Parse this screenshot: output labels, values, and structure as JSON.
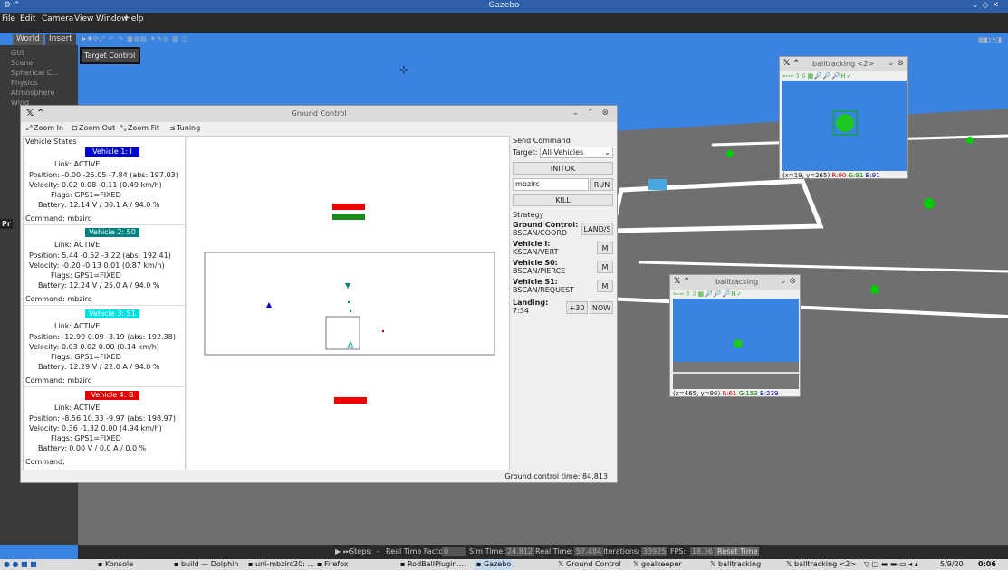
{
  "gazebo": {
    "title": "Gazebo",
    "menu": [
      "File",
      "Edit",
      "Camera",
      "View",
      "Window",
      "Help"
    ],
    "tabs": [
      "World",
      "Insert"
    ],
    "left_items": [
      "GUI",
      "Scene",
      "Spherical C...",
      "Physics",
      "Atmosphere",
      "Wind"
    ],
    "left_short": "Pr",
    "target_control": "Target Control",
    "status": {
      "steps": "Steps:",
      "steps_value": "-",
      "rtf_label": "Real Time Factor:",
      "rtf_value": "0",
      "sim_label": "Sim Time:",
      "sim_value": "24.812",
      "real_label": "Real Time:",
      "real_value": "57.484",
      "iter_label": "Iterations:",
      "iter_value": "33925",
      "fps_label": "FPS:",
      "fps_value": "18.36",
      "reset": "Reset Time"
    }
  },
  "ground_control": {
    "title": "Ground Control",
    "toolbar": [
      "Zoom In",
      "Zoom Out",
      "Zoom Fit",
      "Tuning"
    ],
    "vehicle_states_title": "Vehicle States",
    "vehicles": [
      {
        "badge": "Vehicle 1: I",
        "color": "#0000d0",
        "link": "Link: ACTIVE",
        "position": "Position: -0.00 -25.05 -7.84 (abs: 197.03)",
        "velocity": "Velocity: 0.02 0.08 -0.11 (0.49 km/h)",
        "flags": "Flags: GPS1=FIXED",
        "battery": "Battery: 12.14 V / 30.1 A / 94.0 %",
        "command": "Command: mbzirc"
      },
      {
        "badge": "Vehicle 2: S0",
        "color": "#008080",
        "link": "Link: ACTIVE",
        "position": "Position: 5.44 -0.52 -3.22 (abs: 192.41)",
        "velocity": "Velocity: -0.20 -0.13 0.01 (0.87 km/h)",
        "flags": "Flags: GPS1=FIXED",
        "battery": "Battery: 12.24 V / 25.0 A / 94.0 %",
        "command": "Command: mbzirc"
      },
      {
        "badge": "Vehicle 3: S1",
        "color": "#00e0e0",
        "link": "Link: ACTIVE",
        "position": "Position: -12.99 0.09 -3.19 (abs: 192.38)",
        "velocity": "Velocity: 0.03 0.02 0.00 (0.14 km/h)",
        "flags": "Flags: GPS1=FIXED",
        "battery": "Battery: 12.29 V / 22.0 A / 94.0 %",
        "command": "Command: mbzirc"
      },
      {
        "badge": "Vehicle 4: B",
        "color": "#e00000",
        "link": "Link: ACTIVE",
        "position": "Position: -8.56 10.33 -9.97 (abs: 198.97)",
        "velocity": "Velocity: 0.36 -1.32 0.00 (4.94 km/h)",
        "flags": "Flags: GPS1=FIXED",
        "battery": "Battery: 0.00 V / 0.0 A / 0.0 %",
        "command": "Command:"
      }
    ],
    "send_command": {
      "title": "Send Command",
      "target_label": "Target:",
      "target_value": "All Vehicles",
      "initok": "INITOK",
      "input_value": "mbzirc",
      "run": "RUN",
      "kill": "KILL"
    },
    "strategy": {
      "title": "Strategy",
      "rows": [
        {
          "name": "Ground Control:",
          "mode": "BSCAN/COORD",
          "button": "LAND/S"
        },
        {
          "name": "Vehicle I:",
          "mode": "KSCAN/VERT",
          "button": "M"
        },
        {
          "name": "Vehicle S0:",
          "mode": "BSCAN/PIERCE",
          "button": "M"
        },
        {
          "name": "Vehicle S1:",
          "mode": "BSCAN/REQUEST",
          "button": "M"
        }
      ],
      "landing_label": "Landing:",
      "landing_time": "7:34",
      "plus30": "+30",
      "now": "NOW"
    },
    "status": "Ground control time: 84.813"
  },
  "balltracking_1": {
    "title": "balltracking <2>",
    "coords": "(x=19, y=265)",
    "r": "R:90",
    "g": "G:91",
    "b": "B:91"
  },
  "balltracking_2": {
    "title": "balltracking",
    "coords": "(x=465, y=96)",
    "r": "R:61",
    "g": "G:153",
    "b": "B:239"
  },
  "taskbar": {
    "items": [
      "Konsole",
      "build — Dolphin",
      "uni-mbzirc20: ...",
      "Firefox",
      "RodBallPlugin....",
      "Gazebo",
      "Ground Control",
      "goalkeeper",
      "balltracking",
      "balltracking <2>"
    ],
    "date": "5/9/20",
    "time": "0:06"
  },
  "icons": [
    "x-app-icon",
    "chevron-up-icon",
    "chevron-down-icon",
    "close-icon",
    "zoom-in-icon",
    "zoom-out-icon",
    "zoom-fit-icon",
    "tuning-icon",
    "play-icon",
    "step-icon"
  ]
}
